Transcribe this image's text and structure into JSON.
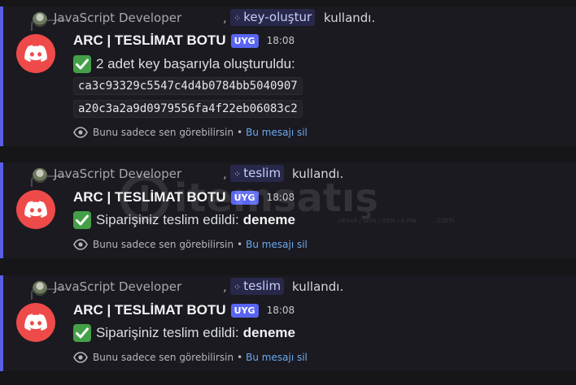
{
  "messages": [
    {
      "reply": {
        "username": "JavaScript Developer",
        "comma": ",",
        "command": "key-oluştur",
        "used": "kullandı."
      },
      "author": {
        "name": "ARC | TESLİMAT BOTU",
        "tag": "UYG",
        "time": "18:08"
      },
      "text": "2 adet key başarıyla oluşturuldu:",
      "codes": [
        "ca3c93329c5547c4d4b0784bb5040907",
        "a20c3a2a9d0979556fa4f22eb06083c2"
      ],
      "ephemeral": {
        "notice": "Bunu sadece sen görebilirsin",
        "separator": "•",
        "delete_link": "Bu mesajı sil"
      }
    },
    {
      "reply": {
        "username": "JavaScript Developer",
        "comma": ",",
        "command": "teslim",
        "used": "kullandı."
      },
      "author": {
        "name": "ARC | TESLİMAT BOTU",
        "tag": "UYG",
        "time": "18:08"
      },
      "text": "Siparişiniz teslim edildi:",
      "bold": "deneme",
      "ephemeral": {
        "notice": "Bunu sadece sen görebilirsin",
        "separator": "•",
        "delete_link": "Bu mesajı sil"
      }
    },
    {
      "reply": {
        "username": "JavaScript Developer",
        "comma": ",",
        "command": "teslim",
        "used": "kullandı."
      },
      "author": {
        "name": "ARC | TESLİMAT BOTU",
        "tag": "UYG",
        "time": "18:08"
      },
      "text": "Siparişiniz teslim edildi:",
      "bold": "deneme",
      "ephemeral": {
        "notice": "Bunu sadece sen görebilirsin",
        "separator": "•",
        "delete_link": "Bu mesajı sil"
      }
    }
  ],
  "watermark": {
    "brand": "itemsatış",
    "sub": "HESAP / SKIN / ITEM / E-PIN",
    "dotcom": ".com"
  },
  "colors": {
    "accent_bar": "#5a5ee6",
    "avatar": "#ef4a4a",
    "app_tag": "#5865f2",
    "check": "#44a048",
    "link": "#6aa8f0"
  }
}
